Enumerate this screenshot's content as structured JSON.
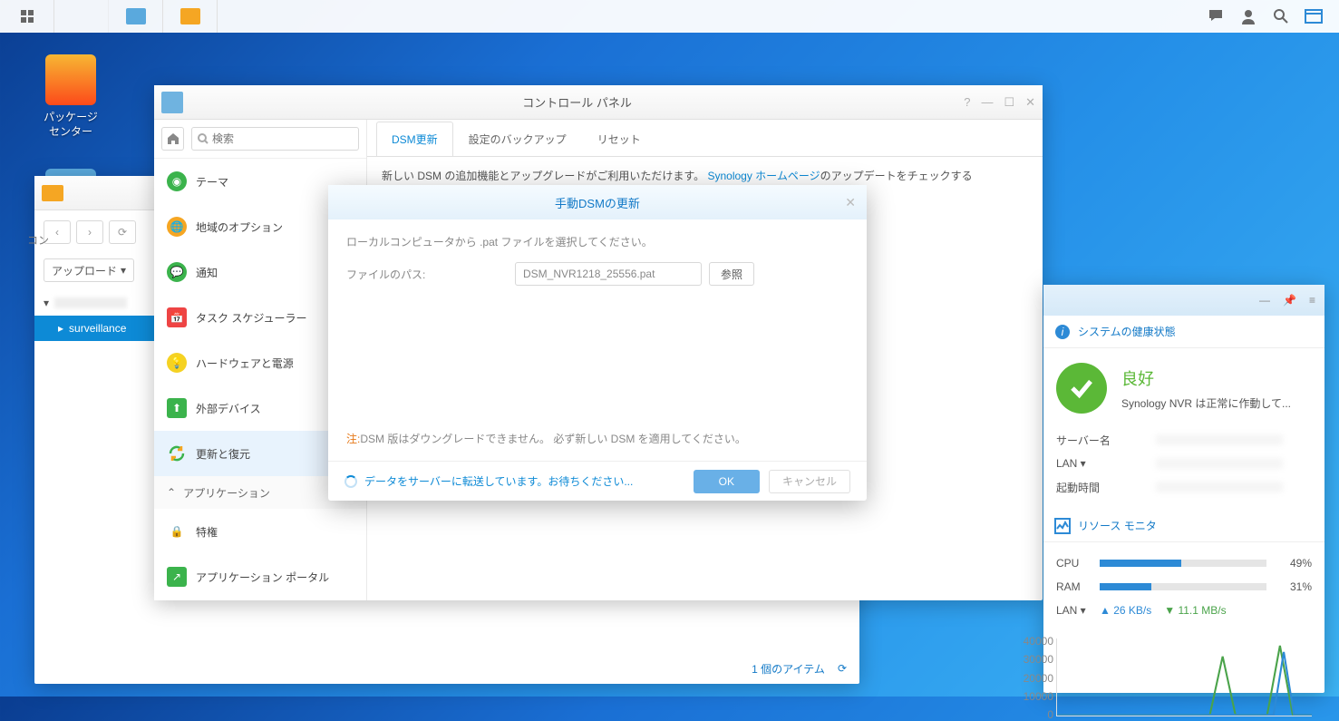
{
  "taskbar": {},
  "desktop": {
    "packageCenter": "パッケージ\nセンター"
  },
  "fileStation": {
    "upload": "アップロード",
    "folder": "surveillance",
    "footer": "1 個のアイテム",
    "truncLabel": "コン"
  },
  "controlPanel": {
    "title": "コントロール パネル",
    "searchPlaceholder": "検索",
    "items": {
      "theme": "テーマ",
      "region": "地域のオプション",
      "notify": "通知",
      "task": "タスク スケジューラー",
      "hw": "ハードウェアと電源",
      "ext": "外部デバイス",
      "update": "更新と復元",
      "appSection": "アプリケーション",
      "priv": "特権",
      "portal": "アプリケーション ポータル"
    },
    "tabs": {
      "dsm": "DSM更新",
      "backup": "設定のバックアップ",
      "reset": "リセット"
    },
    "infoPre": "新しい DSM の追加機能とアップグレードがご利用いただけます。 ",
    "infoLink": "Synology ホームページ",
    "infoPost": "のアップデートをチェックする"
  },
  "dialog": {
    "title": "手動DSMの更新",
    "instruction": "ローカルコンピュータから .pat ファイルを選択してください。",
    "fileLabel": "ファイルのパス:",
    "fileValue": "DSM_NVR1218_25556.pat",
    "browse": "参照",
    "noteLabel": "注:",
    "note": "DSM 版はダウングレードできません。 必ず新しい DSM を適用してください。",
    "status": "データをサーバーに転送しています。お待ちください...",
    "ok": "OK",
    "cancel": "キャンセル"
  },
  "widget": {
    "healthTitle": "システムの健康状態",
    "healthGood": "良好",
    "healthSub": "Synology NVR は正常に作動して...",
    "kv": {
      "server": "サーバー名",
      "lan": "LAN ▾",
      "uptime": "起動時間"
    },
    "resTitle": "リソース モニタ",
    "cpu": "CPU",
    "cpuVal": "49%",
    "cpuPct": 49,
    "ram": "RAM",
    "ramVal": "31%",
    "ramPct": 31,
    "lan": "LAN ▾",
    "up": "▲ 26 KB/s",
    "dn": "▼ 11.1 MB/s",
    "yticks": [
      "40000",
      "30000",
      "20000",
      "10000",
      "0"
    ]
  }
}
